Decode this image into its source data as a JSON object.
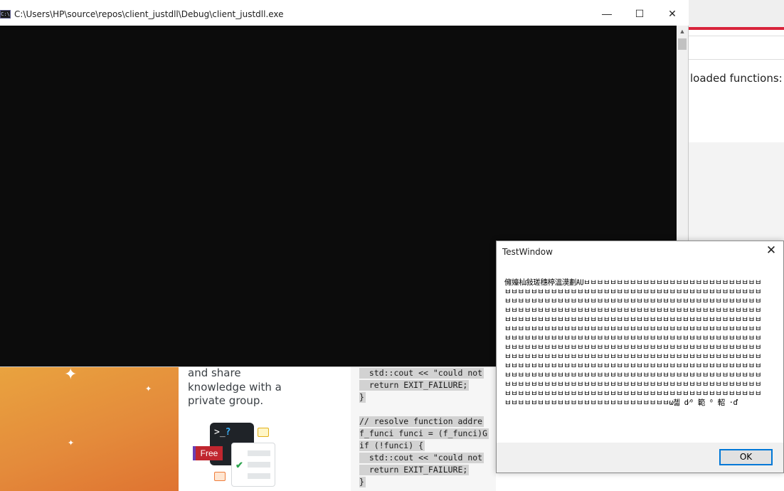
{
  "background_page": {
    "loaded_text": "loaded functions:",
    "promo_lines": [
      "and share",
      "knowledge with a",
      "private group."
    ],
    "free_badge": "Free",
    "terminal_prompt": ">_",
    "terminal_question": "?",
    "code_lines": [
      "  std::cout << \"could not",
      "  return EXIT_FAILURE;",
      "}",
      "",
      "// resolve function addre",
      "f_funci funci = (f_funci)G",
      "if (!funci) {",
      "  std::cout << \"could not",
      "  return EXIT_FAILURE;",
      "}"
    ]
  },
  "console_window": {
    "title": "C:\\Users\\HP\\source\\repos\\client_justdll\\Debug\\client_justdll.exe",
    "icon": "console-app-icon",
    "icon_label": "C:\\",
    "minimize_glyph": "—",
    "maximize_glyph": "☐",
    "close_glyph": "✕",
    "scroll_up_glyph": "▲"
  },
  "message_box": {
    "title": "TestWindow",
    "close_glyph": "✕",
    "body_first": "㒕嬯杣敍瑳穗楟溫漠劃㍳",
    "body_repeat_char": "ㅂ",
    "body_tail": "ω쳷 d⁄⁰ 範 ⁰ 軺 ·ď",
    "ok_label": "OK"
  }
}
